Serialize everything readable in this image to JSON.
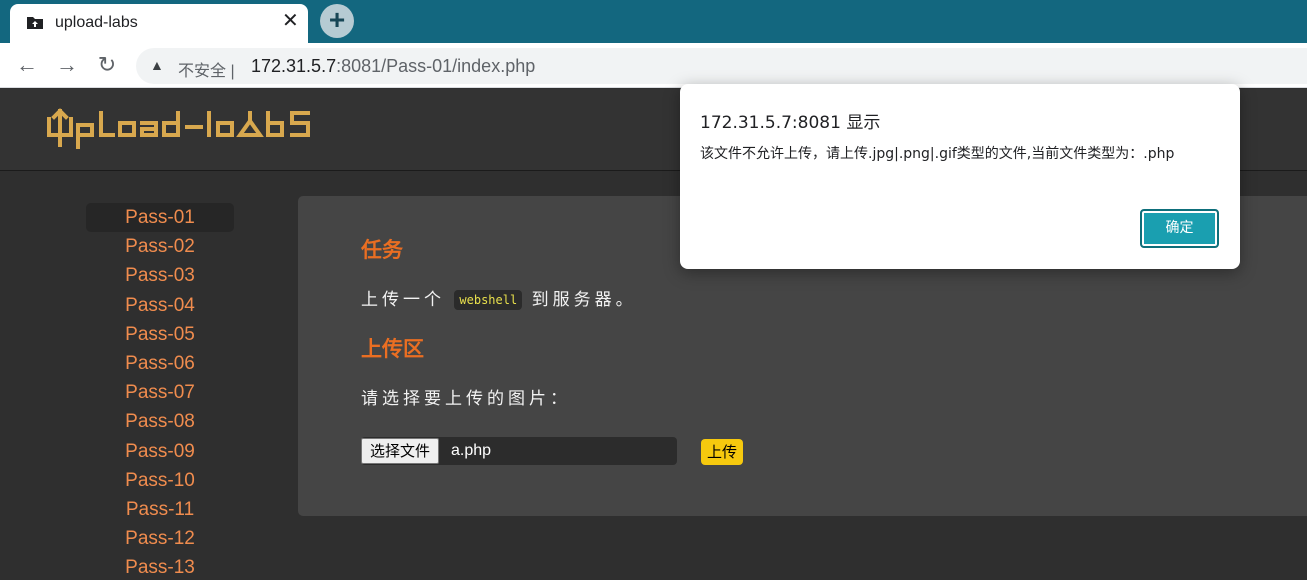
{
  "browser": {
    "tab_title": "upload-labs",
    "tab_close": "✕",
    "new_tab": "+",
    "back": "←",
    "forward": "→",
    "reload": "↻",
    "warning_icon": "▲",
    "security_label": "不安全 |",
    "url_host": "172.31.5.7",
    "url_rest": ":8081/Pass-01/index.php"
  },
  "sidebar": {
    "items": [
      "Pass-01",
      "Pass-02",
      "Pass-03",
      "Pass-04",
      "Pass-05",
      "Pass-06",
      "Pass-07",
      "Pass-08",
      "Pass-09",
      "Pass-10",
      "Pass-11",
      "Pass-12",
      "Pass-13"
    ],
    "active_index": 0
  },
  "main": {
    "task_heading": "任务",
    "task_text_before": "上传一个",
    "task_code": "webshell",
    "task_text_after": "到服务器。",
    "upload_heading": "上传区",
    "choose_prompt": "请选择要上传的图片：",
    "choose_button": "选择文件",
    "file_name": "a.php",
    "upload_button": "上传"
  },
  "dialog": {
    "title": "172.31.5.7:8081 显示",
    "message": "该文件不允许上传，请上传.jpg|.png|.gif类型的文件,当前文件类型为：.php",
    "ok_button": "确定"
  },
  "colors": {
    "tabbar": "#13677f",
    "accent_orange": "#ea6e22",
    "sidebar_link": "#f08c4e",
    "logo_gold": "#d8a84e",
    "upload_button": "#f6c90e",
    "dialog_button": "#1a9fb0"
  }
}
